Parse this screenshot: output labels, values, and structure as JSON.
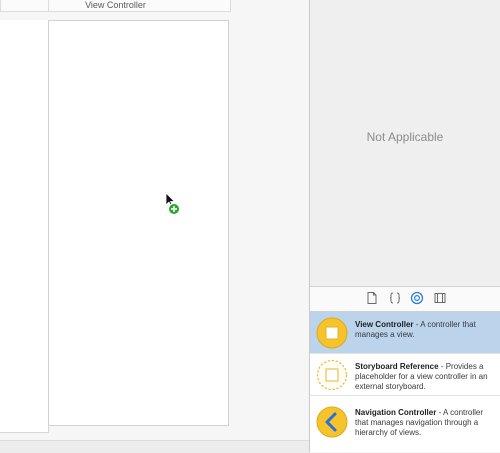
{
  "canvas": {
    "scene_title": "View Controller"
  },
  "inspector": {
    "empty_message": "Not Applicable"
  },
  "library_tabs": [
    {
      "icon": "file-template-icon"
    },
    {
      "icon": "code-snippet-icon"
    },
    {
      "icon": "object-library-icon",
      "selected": true
    },
    {
      "icon": "media-library-icon"
    }
  ],
  "library": {
    "items": [
      {
        "name": "View Controller",
        "description": " - A controller that manages a view.",
        "selected": true
      },
      {
        "name": "Storyboard Reference",
        "description": " - Provides a placeholder for a view controller in an external storyboard."
      },
      {
        "name": "Navigation Controller",
        "description": " - A controller that manages navigation through a hierarchy of views."
      }
    ]
  },
  "colors": {
    "accent": "#2a7de1",
    "item_selected": "#bcd3ec",
    "icon_yellow": "#f5c32c",
    "add_badge": "#29a82b"
  }
}
